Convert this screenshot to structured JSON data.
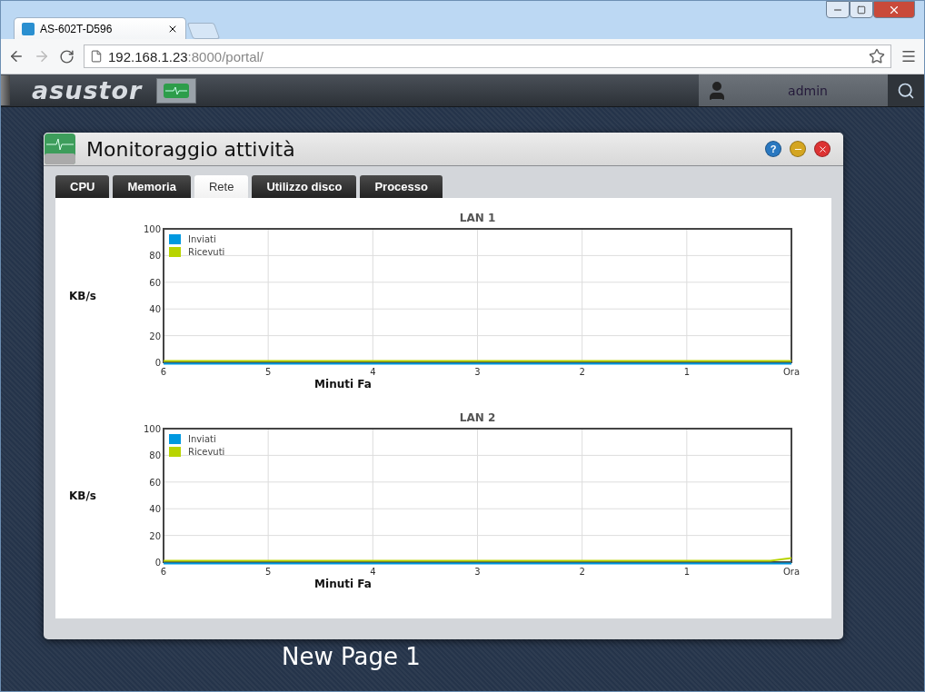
{
  "browser": {
    "tab_title": "AS-602T-D596",
    "url_host": "192.168.1.23",
    "url_path": ":8000/portal/"
  },
  "topbar": {
    "logo": "asustor",
    "user": "admin"
  },
  "window": {
    "title": "Monitoraggio attività",
    "help_label": "?",
    "tabs": [
      {
        "label": "CPU",
        "selected": false
      },
      {
        "label": "Memoria",
        "selected": false
      },
      {
        "label": "Rete",
        "selected": true
      },
      {
        "label": "Utilizzo disco",
        "selected": false
      },
      {
        "label": "Processo",
        "selected": false
      }
    ],
    "charts": [
      {
        "chart_data": {
          "type": "line",
          "grid": true,
          "legend": true,
          "title": "LAN 1",
          "xlabel": "Minuti Fa",
          "ylabel": "KB/s",
          "x": [
            6,
            5,
            4,
            3,
            2,
            1,
            0
          ],
          "xlim": [
            6,
            0
          ],
          "ylim": [
            0,
            100
          ],
          "xticks": [
            6,
            5,
            4,
            3,
            2,
            1,
            {
              "value": 0,
              "label": "Ora"
            }
          ],
          "yticks": [
            0,
            20,
            40,
            60,
            80,
            100
          ],
          "series": [
            {
              "name": "Inviati",
              "color": "#0099e0",
              "values": [
                0,
                0,
                0,
                0,
                0,
                0,
                0
              ]
            },
            {
              "name": "Ricevuti",
              "color": "#b8d400",
              "values": [
                0,
                0,
                0,
                0,
                0,
                0,
                0
              ]
            }
          ]
        }
      },
      {
        "chart_data": {
          "type": "line",
          "grid": true,
          "legend": true,
          "title": "LAN 2",
          "xlabel": "Minuti Fa",
          "ylabel": "KB/s",
          "x": [
            6,
            5,
            4,
            3,
            2,
            1,
            0.2,
            0
          ],
          "xlim": [
            6,
            0
          ],
          "ylim": [
            0,
            100
          ],
          "xticks": [
            6,
            5,
            4,
            3,
            2,
            1,
            {
              "value": 0,
              "label": "Ora"
            }
          ],
          "yticks": [
            0,
            20,
            40,
            60,
            80,
            100
          ],
          "series": [
            {
              "name": "Inviati",
              "color": "#0099e0",
              "values": [
                0,
                0,
                0,
                0,
                0,
                0,
                0,
                0
              ]
            },
            {
              "name": "Ricevuti",
              "color": "#b8d400",
              "values": [
                0,
                0,
                0,
                0,
                0,
                0,
                0,
                2
              ]
            }
          ]
        }
      }
    ]
  },
  "desktop_label": "New Page 1"
}
